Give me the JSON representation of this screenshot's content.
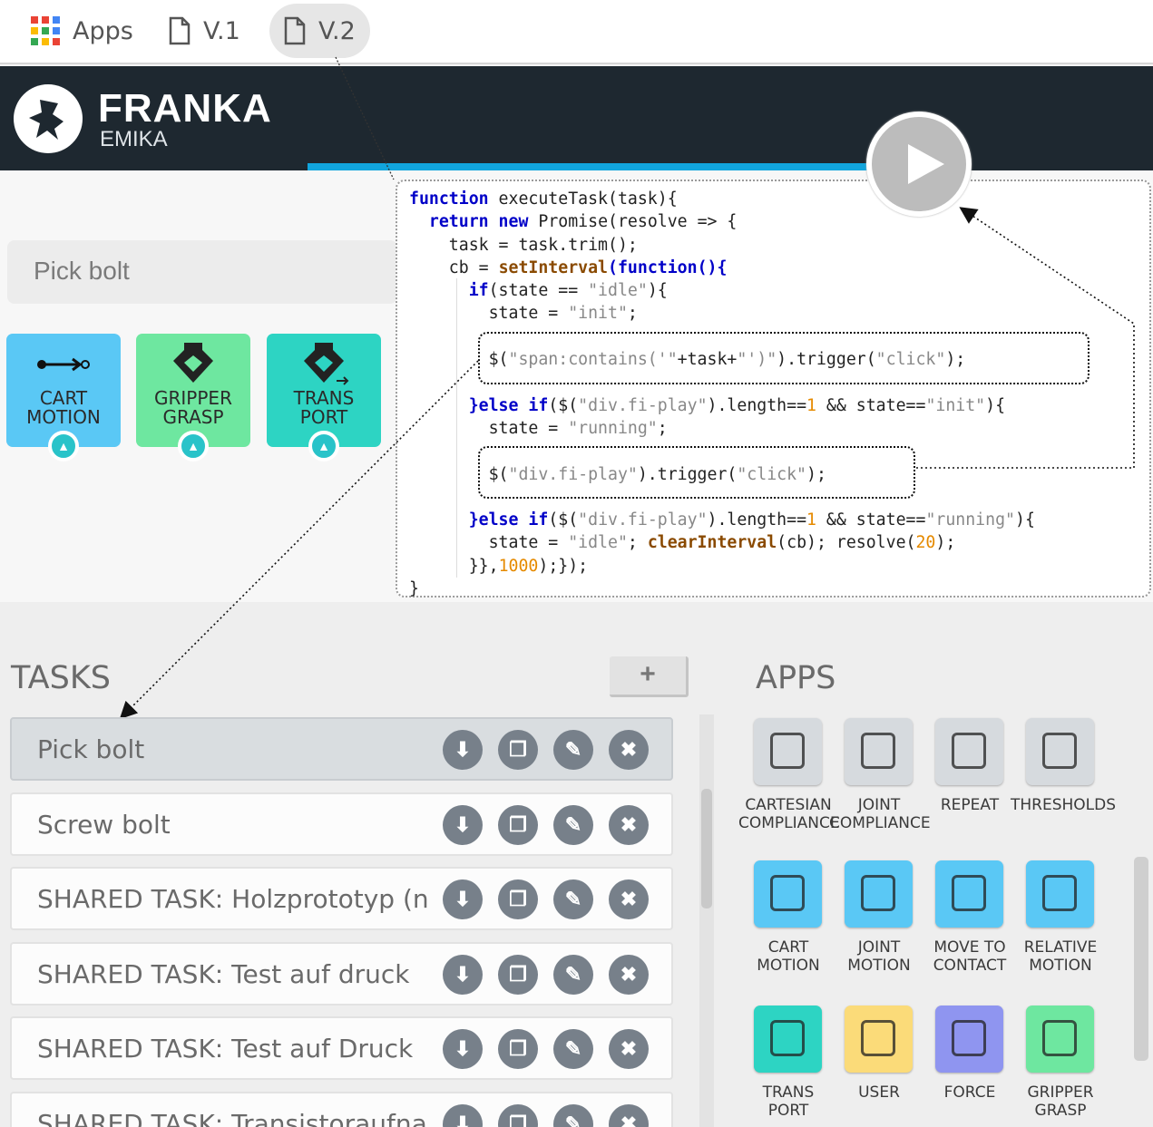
{
  "bookmarks": {
    "apps": "Apps",
    "v1": "V.1",
    "v2": "V.2"
  },
  "brand": {
    "name": "FRANKA",
    "sub": "EMIKA"
  },
  "current_task": "Pick bolt",
  "timeline": [
    {
      "label1": "CART",
      "label2": "MOTION",
      "color": "#5ac8f5"
    },
    {
      "label1": "GRIPPER",
      "label2": "GRASP",
      "color": "#6ee7a0"
    },
    {
      "label1": "TRANS",
      "label2": "PORT",
      "color": "#2dd4c3"
    }
  ],
  "code": {
    "l1a": "function",
    "l1b": " executeTask(task){",
    "l2a": "  return",
    "l2b": " new",
    "l2c": " Promise(resolve => {",
    "l3": "    task = task.trim();",
    "l4a": "    cb = ",
    "l4b": "setInterval",
    "l4c": "(function(){",
    "l5a": "      if",
    "l5b": "(state == ",
    "l5c": "\"idle\"",
    "l5d": "){",
    "l6a": "        state = ",
    "l6b": "\"init\"",
    "l6c": ";",
    "l7a": "        $(",
    "l7b": "\"span:contains('\"",
    "l7c": "+task+",
    "l7d": "\"')\"",
    "l7e": ").trigger(",
    "l7f": "\"click\"",
    "l7g": ");",
    "l8a": "      }else if",
    "l8b": "($(",
    "l8c": "\"div.fi-play\"",
    "l8d": ").length==",
    "l8e": "1",
    "l8f": " && state==",
    "l8g": "\"init\"",
    "l8h": "){",
    "l9a": "        state = ",
    "l9b": "\"running\"",
    "l9c": ";",
    "l10a": "        $(",
    "l10b": "\"div.fi-play\"",
    "l10c": ").trigger(",
    "l10d": "\"click\"",
    "l10e": ");",
    "l11a": "      }else if",
    "l11b": "($(",
    "l11c": "\"div.fi-play\"",
    "l11d": ").length==",
    "l11e": "1",
    "l11f": " && state==",
    "l11g": "\"running\"",
    "l11h": "){",
    "l12a": "        state = ",
    "l12b": "\"idle\"",
    "l12c": "; ",
    "l12d": "clearInterval",
    "l12e": "(cb); resolve(",
    "l12f": "20",
    "l12g": ");",
    "l13a": "      }},",
    "l13b": "1000",
    "l13c": ");});",
    "l14": "}"
  },
  "tasks": {
    "title": "TASKS",
    "add": "+",
    "rows": [
      "Pick bolt",
      "Screw bolt",
      "SHARED TASK: Holzprototyp (neu)",
      "SHARED TASK: Test auf druck",
      "SHARED TASK: Test auf Druck",
      "SHARED TASK: Transistoraufnahme"
    ]
  },
  "apps": {
    "title": "APPS",
    "items": [
      {
        "l1": "CARTESIAN",
        "l2": "COMPLIANCE",
        "color": "#d6dade"
      },
      {
        "l1": "JOINT",
        "l2": "COMPLIANCE",
        "color": "#d6dade"
      },
      {
        "l1": "REPEAT",
        "l2": "",
        "color": "#d6dade"
      },
      {
        "l1": "THRESHOLDS",
        "l2": "",
        "color": "#d6dade"
      },
      {
        "l1": "CART",
        "l2": "MOTION",
        "color": "#5ac8f5"
      },
      {
        "l1": "JOINT",
        "l2": "MOTION",
        "color": "#5ac8f5"
      },
      {
        "l1": "MOVE TO",
        "l2": "CONTACT",
        "color": "#5ac8f5"
      },
      {
        "l1": "RELATIVE",
        "l2": "MOTION",
        "color": "#5ac8f5"
      },
      {
        "l1": "TRANS",
        "l2": "PORT",
        "color": "#2dd4c3"
      },
      {
        "l1": "USER",
        "l2": "",
        "color": "#fbdb79"
      },
      {
        "l1": "FORCE",
        "l2": "",
        "color": "#8f95f0"
      },
      {
        "l1": "GRIPPER",
        "l2": "GRASP",
        "color": "#6ee7a0"
      }
    ]
  }
}
